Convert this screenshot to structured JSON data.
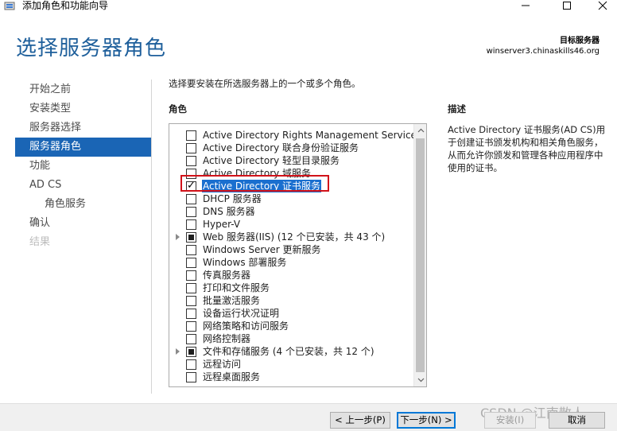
{
  "window": {
    "title": "添加角色和功能向导",
    "controls": {
      "minimize": "minimize",
      "maximize": "maximize",
      "close": "close"
    }
  },
  "header": {
    "page_title": "选择服务器角色",
    "target_label": "目标服务器",
    "target_value": "winserver3.chinaskills46.org"
  },
  "nav": {
    "items": [
      {
        "label": "开始之前",
        "state": "normal"
      },
      {
        "label": "安装类型",
        "state": "normal"
      },
      {
        "label": "服务器选择",
        "state": "normal"
      },
      {
        "label": "服务器角色",
        "state": "active"
      },
      {
        "label": "功能",
        "state": "normal"
      },
      {
        "label": "AD CS",
        "state": "normal"
      },
      {
        "label": "角色服务",
        "state": "sub"
      },
      {
        "label": "确认",
        "state": "normal"
      },
      {
        "label": "结果",
        "state": "disabled"
      }
    ]
  },
  "main": {
    "instruction": "选择要安装在所选服务器上的一个或多个角色。",
    "roles_header": "角色",
    "roles": [
      {
        "label": "Active Directory Rights Management Services",
        "checked": false
      },
      {
        "label": "Active Directory 联合身份验证服务",
        "checked": false
      },
      {
        "label": "Active Directory 轻型目录服务",
        "checked": false
      },
      {
        "label": "Active Directory 域服务",
        "checked": false
      },
      {
        "label": "Active Directory 证书服务",
        "checked": true,
        "selected": true
      },
      {
        "label": "DHCP 服务器",
        "checked": false
      },
      {
        "label": "DNS 服务器",
        "checked": false
      },
      {
        "label": "Hyper-V",
        "checked": false
      },
      {
        "label": "Web 服务器(IIS) (12 个已安装，共 43 个)",
        "checked": "partial",
        "expandable": true
      },
      {
        "label": "Windows Server 更新服务",
        "checked": false
      },
      {
        "label": "Windows 部署服务",
        "checked": false
      },
      {
        "label": "传真服务器",
        "checked": false
      },
      {
        "label": "打印和文件服务",
        "checked": false
      },
      {
        "label": "批量激活服务",
        "checked": false
      },
      {
        "label": "设备运行状况证明",
        "checked": false
      },
      {
        "label": "网络策略和访问服务",
        "checked": false
      },
      {
        "label": "网络控制器",
        "checked": false
      },
      {
        "label": "文件和存储服务 (4 个已安装，共 12 个)",
        "checked": "partial",
        "expandable": true
      },
      {
        "label": "远程访问",
        "checked": false
      },
      {
        "label": "远程桌面服务",
        "checked": false
      }
    ],
    "description_header": "描述",
    "description": "Active Directory 证书服务(AD CS)用于创建证书颁发机构和相关角色服务，从而允许你颁发和管理各种应用程序中使用的证书。"
  },
  "footer": {
    "previous": "< 上一步(P)",
    "next": "下一步(N) >",
    "install": "安装(I)",
    "cancel": "取消",
    "watermark": "CSDN @江南散人"
  },
  "colors": {
    "accent": "#1a65b5",
    "title_blue": "#1e5f9b",
    "highlight_red": "#d1121a"
  }
}
